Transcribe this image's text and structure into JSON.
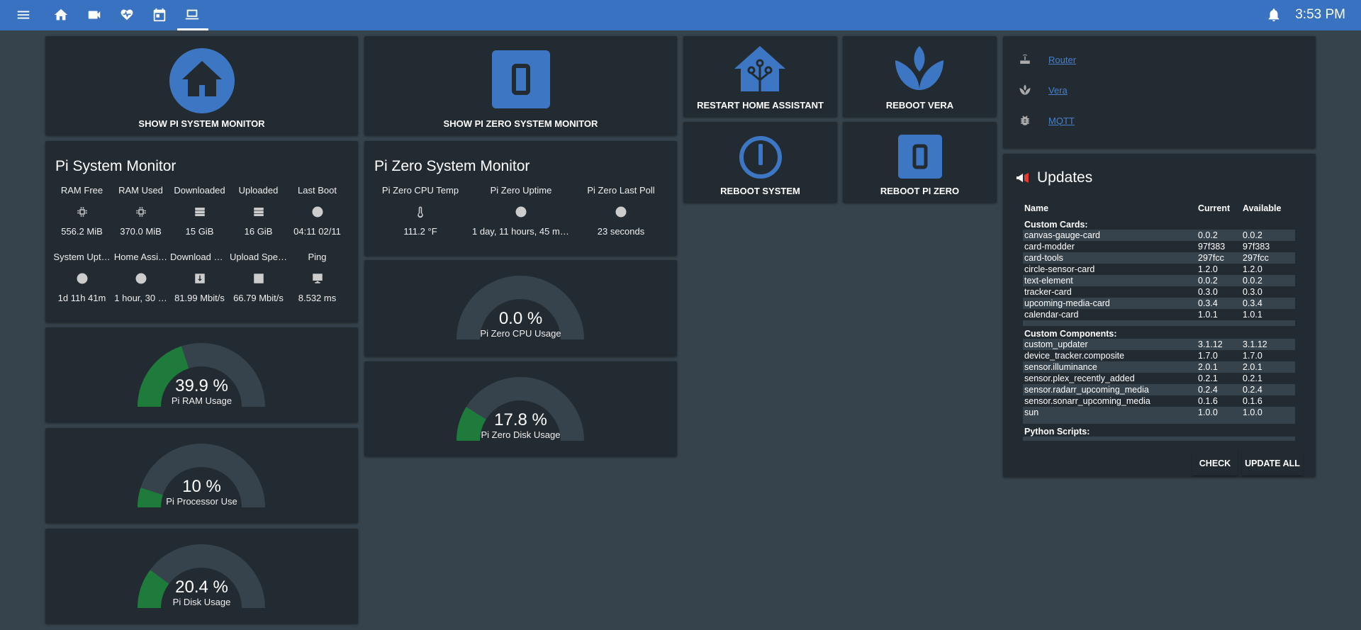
{
  "topbar": {
    "icons": [
      "menu-icon",
      "home-icon",
      "video-camera-icon",
      "heart-pulse-icon",
      "calendar-icon",
      "monitor-icon"
    ],
    "time": "3:53 PM"
  },
  "buttons": {
    "show_pi": "SHOW PI SYSTEM MONITOR",
    "show_pi_zero": "SHOW PI ZERO SYSTEM MONITOR",
    "restart_ha": "RESTART HOME ASSISTANT",
    "reboot_vera": "REBOOT VERA",
    "reboot_system": "REBOOT SYSTEM",
    "reboot_pi_zero": "REBOOT PI ZERO"
  },
  "pi_monitor": {
    "title": "Pi System Monitor",
    "row1": [
      {
        "label": "RAM Free",
        "icon": "chip-icon",
        "value": "556.2 MiB"
      },
      {
        "label": "RAM Used",
        "icon": "chip-icon",
        "value": "370.0 MiB"
      },
      {
        "label": "Downloaded",
        "icon": "server-icon",
        "value": "15 GiB"
      },
      {
        "label": "Uploaded",
        "icon": "server-icon",
        "value": "16 GiB"
      },
      {
        "label": "Last Boot",
        "icon": "clock-icon",
        "value": "04:11 02/11"
      }
    ],
    "row2": [
      {
        "label": "System Upt…",
        "icon": "clock-icon",
        "value": "1d 11h 41m"
      },
      {
        "label": "Home Assi…",
        "icon": "clock-icon",
        "value": "1 hour, 30 …"
      },
      {
        "label": "Download S…",
        "icon": "download-icon",
        "value": "81.99 Mbit/s"
      },
      {
        "label": "Upload Spe…",
        "icon": "upload-icon",
        "value": "66.79 Mbit/s"
      },
      {
        "label": "Ping",
        "icon": "desktop-icon",
        "value": "8.532 ms"
      }
    ]
  },
  "pi_zero_monitor": {
    "title": "Pi Zero System Monitor",
    "items": [
      {
        "label": "Pi Zero CPU Temp",
        "icon": "thermometer-icon",
        "value": "111.2 °F"
      },
      {
        "label": "Pi Zero Uptime",
        "icon": "clock-icon",
        "value": "1 day, 11 hours, 45 mi…"
      },
      {
        "label": "Pi Zero Last Poll",
        "icon": "clock-icon",
        "value": "23 seconds"
      }
    ]
  },
  "gauges": {
    "pi_ram": {
      "value": "39.9 %",
      "name": "Pi RAM Usage",
      "fraction": 0.399
    },
    "pi_proc": {
      "value": "10 %",
      "name": "Pi Processor Use",
      "fraction": 0.1
    },
    "pi_disk": {
      "value": "20.4 %",
      "name": "Pi Disk Usage",
      "fraction": 0.204
    },
    "zero_cpu": {
      "value": "0.0 %",
      "name": "Pi Zero CPU Usage",
      "fraction": 0.0
    },
    "zero_disk": {
      "value": "17.8 %",
      "name": "Pi Zero Disk Usage",
      "fraction": 0.178
    }
  },
  "colors": {
    "accent": "#3d77c4",
    "gauge_fill": "#1e7b3b",
    "gauge_track": "#37434c",
    "topbar": "#3872c0"
  },
  "links": [
    {
      "label": "Router",
      "icon": "router-icon"
    },
    {
      "label": "Vera",
      "icon": "vera-leaf-icon"
    },
    {
      "label": "MQTT",
      "icon": "bug-icon"
    }
  ],
  "updates": {
    "title": "Updates",
    "headers": {
      "name": "Name",
      "current": "Current",
      "available": "Available"
    },
    "sections": [
      {
        "title": "Custom Cards:",
        "rows": [
          [
            "canvas-gauge-card",
            "0.0.2",
            "0.0.2"
          ],
          [
            "card-modder",
            "97f383",
            "97f383"
          ],
          [
            "card-tools",
            "297fcc",
            "297fcc"
          ],
          [
            "circle-sensor-card",
            "1.2.0",
            "1.2.0"
          ],
          [
            "text-element",
            "0.0.2",
            "0.0.2"
          ],
          [
            "tracker-card",
            "0.3.0",
            "0.3.0"
          ],
          [
            "upcoming-media-card",
            "0.3.4",
            "0.3.4"
          ],
          [
            "calendar-card",
            "1.0.1",
            "1.0.1"
          ]
        ]
      },
      {
        "title": "Custom Components:",
        "rows": [
          [
            "custom_updater",
            "3.1.12",
            "3.1.12"
          ],
          [
            "device_tracker.composite",
            "1.7.0",
            "1.7.0"
          ],
          [
            "sensor.illuminance",
            "2.0.1",
            "2.0.1"
          ],
          [
            "sensor.plex_recently_added",
            "0.2.1",
            "0.2.1"
          ],
          [
            "sensor.radarr_upcoming_media",
            "0.2.4",
            "0.2.4"
          ],
          [
            "sensor.sonarr_upcoming_media",
            "0.1.6",
            "0.1.6"
          ],
          [
            "sun",
            "1.0.0",
            "1.0.0"
          ]
        ]
      },
      {
        "title": "Python Scripts:",
        "rows": []
      }
    ],
    "check_label": "CHECK",
    "update_all_label": "UPDATE ALL"
  }
}
